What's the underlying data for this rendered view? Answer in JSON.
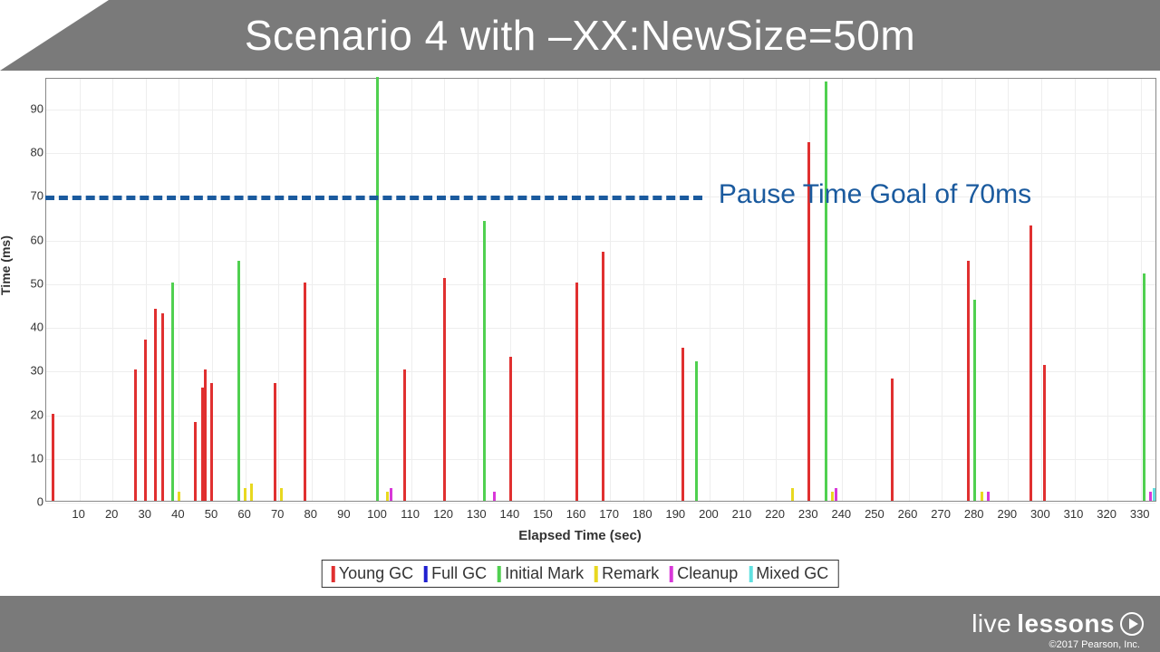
{
  "header": {
    "title": "Scenario 4 with –XX:NewSize=50m"
  },
  "footer": {
    "brand_prefix": "live",
    "brand_suffix": "lessons",
    "copyright": "©2017 Pearson, Inc."
  },
  "chart_data": {
    "type": "bar",
    "title": "",
    "xlabel": "Elapsed Time (sec)",
    "ylabel": "Time (ms)",
    "xlim": [
      0,
      335
    ],
    "ylim": [
      0,
      97
    ],
    "yticks": [
      0,
      10,
      20,
      30,
      40,
      50,
      60,
      70,
      80,
      90
    ],
    "xticks": [
      10,
      20,
      30,
      40,
      50,
      60,
      70,
      80,
      90,
      100,
      110,
      120,
      130,
      140,
      150,
      160,
      170,
      180,
      190,
      200,
      210,
      220,
      230,
      240,
      250,
      260,
      270,
      280,
      290,
      300,
      310,
      320,
      330
    ],
    "annotation": {
      "text": "Pause Time Goal of 70ms",
      "value": 70
    },
    "legend": [
      {
        "name": "Young GC",
        "color": "#e03030"
      },
      {
        "name": "Full GC",
        "color": "#2020d0"
      },
      {
        "name": "Initial Mark",
        "color": "#50d050"
      },
      {
        "name": "Remark",
        "color": "#e8d820"
      },
      {
        "name": "Cleanup",
        "color": "#d838d8"
      },
      {
        "name": "Mixed GC",
        "color": "#60e0e0"
      }
    ],
    "series": [
      {
        "name": "Young GC",
        "color": "#e03030",
        "points": [
          {
            "x": 2,
            "y": 20
          },
          {
            "x": 27,
            "y": 30
          },
          {
            "x": 30,
            "y": 37
          },
          {
            "x": 33,
            "y": 44
          },
          {
            "x": 35,
            "y": 43
          },
          {
            "x": 45,
            "y": 18
          },
          {
            "x": 47,
            "y": 26
          },
          {
            "x": 48,
            "y": 30
          },
          {
            "x": 50,
            "y": 27
          },
          {
            "x": 69,
            "y": 27
          },
          {
            "x": 78,
            "y": 50
          },
          {
            "x": 108,
            "y": 30
          },
          {
            "x": 120,
            "y": 51
          },
          {
            "x": 140,
            "y": 33
          },
          {
            "x": 160,
            "y": 50
          },
          {
            "x": 168,
            "y": 57
          },
          {
            "x": 192,
            "y": 35
          },
          {
            "x": 230,
            "y": 82
          },
          {
            "x": 255,
            "y": 28
          },
          {
            "x": 278,
            "y": 55
          },
          {
            "x": 297,
            "y": 63
          },
          {
            "x": 301,
            "y": 31
          }
        ]
      },
      {
        "name": "Initial Mark",
        "color": "#50d050",
        "points": [
          {
            "x": 38,
            "y": 50
          },
          {
            "x": 58,
            "y": 55
          },
          {
            "x": 100,
            "y": 97
          },
          {
            "x": 132,
            "y": 64
          },
          {
            "x": 196,
            "y": 32
          },
          {
            "x": 235,
            "y": 96
          },
          {
            "x": 280,
            "y": 46
          },
          {
            "x": 331,
            "y": 52
          }
        ]
      },
      {
        "name": "Remark",
        "color": "#e8d820",
        "points": [
          {
            "x": 40,
            "y": 2
          },
          {
            "x": 60,
            "y": 3
          },
          {
            "x": 62,
            "y": 4
          },
          {
            "x": 71,
            "y": 3
          },
          {
            "x": 103,
            "y": 2
          },
          {
            "x": 225,
            "y": 3
          },
          {
            "x": 237,
            "y": 2
          },
          {
            "x": 282,
            "y": 2
          }
        ]
      },
      {
        "name": "Cleanup",
        "color": "#d838d8",
        "points": [
          {
            "x": 104,
            "y": 3
          },
          {
            "x": 135,
            "y": 2
          },
          {
            "x": 238,
            "y": 3
          },
          {
            "x": 284,
            "y": 2
          },
          {
            "x": 333,
            "y": 2
          }
        ]
      },
      {
        "name": "Mixed GC",
        "color": "#60e0e0",
        "points": [
          {
            "x": 334,
            "y": 3
          }
        ]
      }
    ]
  }
}
